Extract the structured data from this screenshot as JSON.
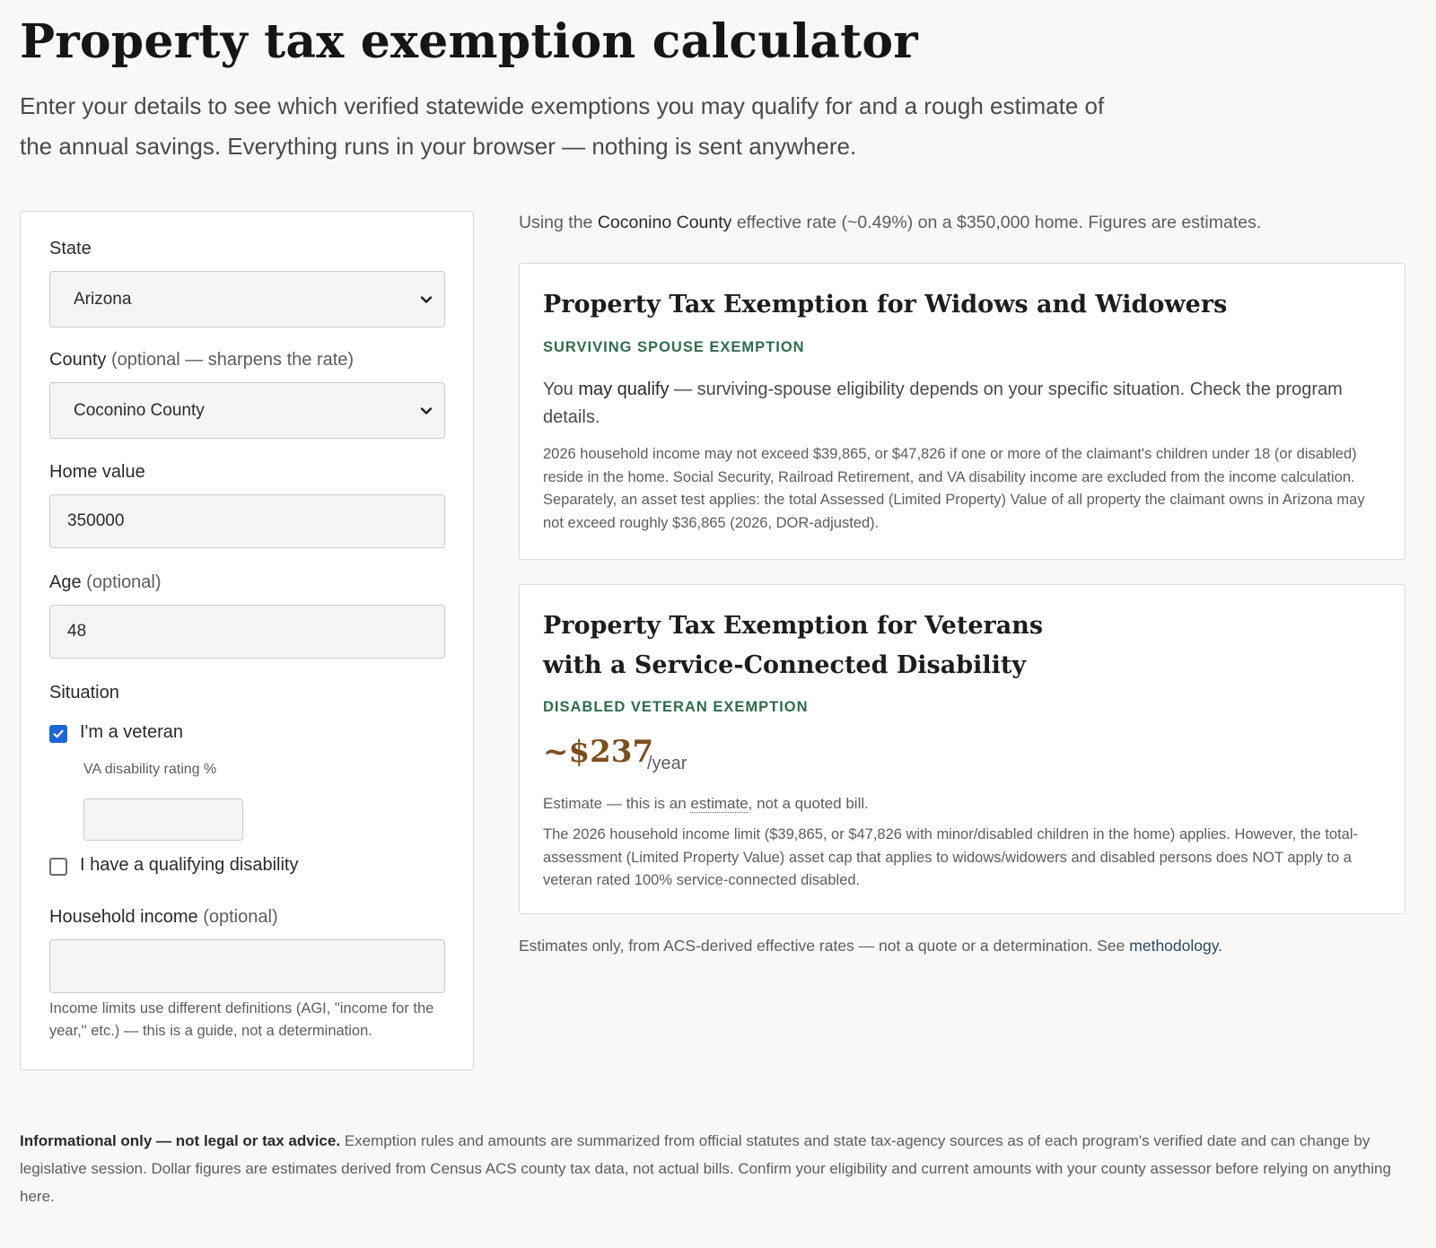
{
  "header": {
    "title": "Property tax exemption calculator",
    "intro": "Enter your details to see which verified statewide exemptions you may qualify for and a rough estimate of the annual savings. Everything runs in your browser — nothing is sent anywhere."
  },
  "form": {
    "state": {
      "label": "State",
      "value": "Arizona"
    },
    "county": {
      "label": "County",
      "hint": "(optional — sharpens the rate)",
      "value": "Coconino County"
    },
    "home_value": {
      "label": "Home value",
      "value": "350000"
    },
    "age": {
      "label": "Age",
      "hint": "(optional)",
      "value": "48"
    },
    "situation": {
      "label": "Situation",
      "veteran": {
        "label": "I'm a veteran",
        "checked": true
      },
      "va_rating_label": "VA disability rating %",
      "va_rating_value": "",
      "disability": {
        "label": "I have a qualifying disability",
        "checked": false
      }
    },
    "income": {
      "label": "Household income",
      "hint": "(optional)",
      "value": "",
      "help": "Income limits use different definitions (AGI, \"income for the year,\" etc.) — this is a guide, not a determination."
    }
  },
  "results": {
    "rate_line": {
      "prefix": "Using the",
      "county": "Coconino County",
      "suffix": "effective rate (~0.49%) on a $350,000 home. Figures are estimates."
    },
    "cards": [
      {
        "title": "Property Tax Exemption for Widows and Widowers",
        "type": "SURVIVING SPOUSE EXEMPTION",
        "lead_prefix": "You",
        "lead_strong": "may qualify",
        "lead_suffix": "— surviving-spouse eligibility depends on your specific situation. Check the program details.",
        "detail": "2026 household income may not exceed $39,865, or $47,826 if one or more of the claimant's children under 18 (or disabled) reside in the home. Social Security, Railroad Retirement, and VA disability income are excluded from the income calculation. Separately, an asset test applies: the total Assessed (Limited Property) Value of all property the claimant owns in Arizona may not exceed roughly $36,865 (2026, DOR-adjusted)."
      },
      {
        "title_line1": "Property Tax Exemption for Veterans",
        "title_line2": "with a Service-Connected Disability",
        "type": "DISABLED VETERAN EXEMPTION",
        "amount": "~$237",
        "per": "/year",
        "estimate_prefix": "Estimate — this is an",
        "estimate_word": "estimate",
        "estimate_suffix": ", not a quoted bill.",
        "detail": "The 2026 household income limit ($39,865, or $47,826 with minor/disabled children in the home) applies. However, the total-assessment (Limited Property Value) asset cap that applies to widows/widowers and disabled persons does NOT apply to a veteran rated 100% service-connected disabled."
      }
    ],
    "footnote": {
      "text": "Estimates only, from ACS-derived effective rates — not a quote or a determination. See",
      "link": "methodology."
    }
  },
  "disclaimer": {
    "strong": "Informational only — not legal or tax advice.",
    "text": "Exemption rules and amounts are summarized from official statutes and state tax-agency sources as of each program's verified date and can change by legislative session. Dollar figures are estimates derived from Census ACS county tax data, not actual bills. Confirm your eligibility and current amounts with your county assessor before relying on anything here."
  },
  "colors": {
    "accent_green": "#2f6b4c",
    "amount_brown": "#7a4f1e",
    "checkbox_blue": "#1a66d9"
  }
}
